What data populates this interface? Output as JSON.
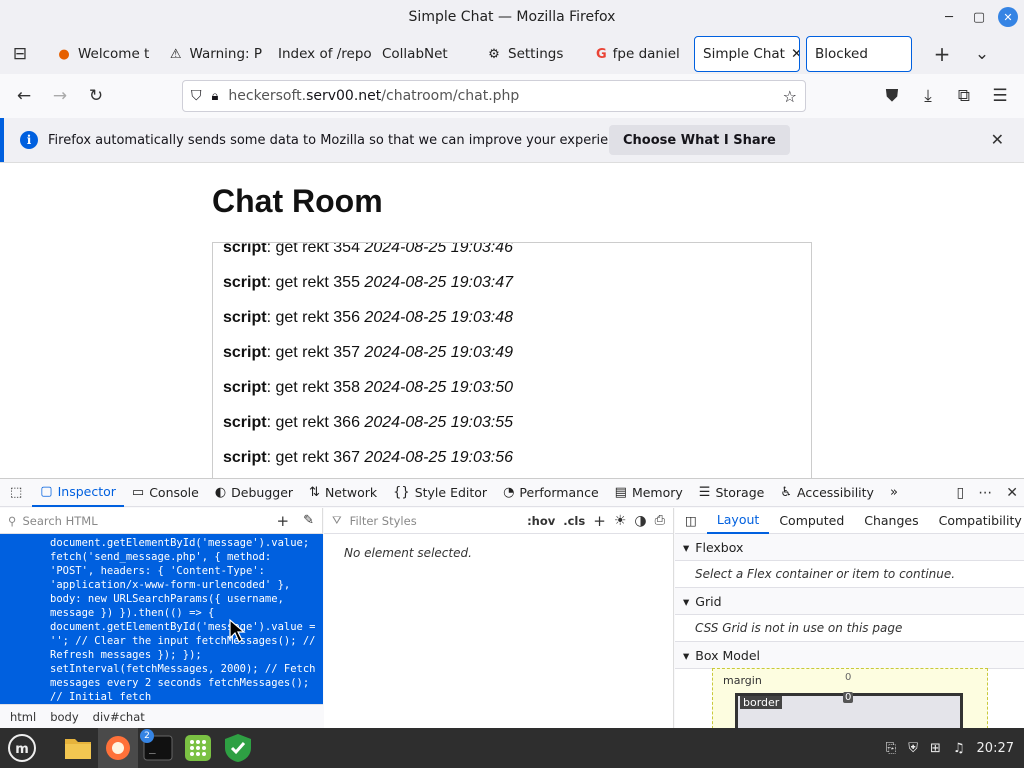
{
  "window": {
    "title": "Simple Chat — Mozilla Firefox"
  },
  "tabs": [
    {
      "label": "Welcome t",
      "icon": "firefox-icon"
    },
    {
      "label": "Warning: P",
      "icon": "warning-icon"
    },
    {
      "label": "Index of /repo",
      "icon": ""
    },
    {
      "label": "CollabNet",
      "icon": ""
    },
    {
      "label": "Settings",
      "icon": "gear-icon"
    },
    {
      "label": "fpe daniel",
      "icon": "google-icon"
    },
    {
      "label": "Simple Chat",
      "icon": "",
      "active": true
    },
    {
      "label": "Blocked",
      "icon": ""
    }
  ],
  "navbar": {
    "url_host": "heckersoft.",
    "url_domain": "serv00.net",
    "url_path": "/chatroom/chat.php"
  },
  "notification": {
    "message": "Firefox automatically sends some data to Mozilla so that we can improve your experience.",
    "button": "Choose What I Share"
  },
  "page": {
    "heading": "Chat Room",
    "messages": [
      {
        "user": "script",
        "text": ": get rekt 354 ",
        "ts": "2024-08-25 19:03:46"
      },
      {
        "user": "script",
        "text": ": get rekt 355 ",
        "ts": "2024-08-25 19:03:47"
      },
      {
        "user": "script",
        "text": ": get rekt 356 ",
        "ts": "2024-08-25 19:03:48"
      },
      {
        "user": "script",
        "text": ": get rekt 357 ",
        "ts": "2024-08-25 19:03:49"
      },
      {
        "user": "script",
        "text": ": get rekt 358 ",
        "ts": "2024-08-25 19:03:50"
      },
      {
        "user": "script",
        "text": ": get rekt 366 ",
        "ts": "2024-08-25 19:03:55"
      },
      {
        "user": "script",
        "text": ": get rekt 367 ",
        "ts": "2024-08-25 19:03:56"
      }
    ]
  },
  "devtools": {
    "tabs": [
      "Inspector",
      "Console",
      "Debugger",
      "Network",
      "Style Editor",
      "Performance",
      "Memory",
      "Storage",
      "Accessibility"
    ],
    "search_placeholder": "Search HTML",
    "filter_placeholder": "Filter Styles",
    "hov": ":hov",
    "cls": ".cls",
    "no_element": "No element selected.",
    "code": "document.getElementById('message').value;\nfetch('send_message.php', { method:\n'POST', headers: { 'Content-Type':\n'application/x-www-form-urlencoded' },\nbody: new URLSearchParams({ username,\nmessage }) }).then(() => {\ndocument.getElementById('message').value =\n''; // Clear the input fetchMessages(); //\nRefresh messages }); });\nsetInterval(fetchMessages, 2000); // Fetch\nmessages every 2 seconds fetchMessages();\n// Initial fetch",
    "breadcrumbs": [
      "html",
      "body",
      "div#chat"
    ],
    "layout_tabs": [
      "Layout",
      "Computed",
      "Changes",
      "Compatibility"
    ],
    "flexbox": {
      "title": "Flexbox",
      "body": "Select a Flex container or item to continue."
    },
    "grid": {
      "title": "Grid",
      "body": "CSS Grid is not in use on this page"
    },
    "boxmodel": {
      "title": "Box Model",
      "margin_label": "margin",
      "margin_val": "0",
      "border_label": "border",
      "border_val": "0"
    }
  },
  "taskbar": {
    "badge": "2",
    "clock": "20:27"
  }
}
